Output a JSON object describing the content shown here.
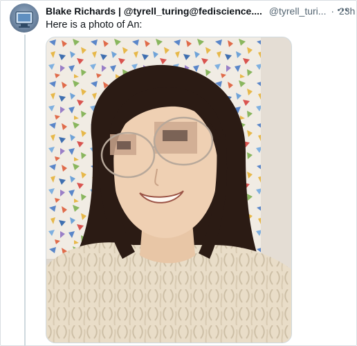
{
  "post": {
    "author_name": "Blake Richards | @tyrell_turing@fediscience....",
    "handle": "@tyrell_turi...",
    "separator": "·",
    "time": "23h",
    "text": "Here is a photo of An:"
  },
  "icons": {
    "more": "more-options-icon",
    "avatar": "avatar-image"
  },
  "colors": {
    "text_primary": "#0f1419",
    "text_secondary": "#536471",
    "border": "#cfd9de"
  }
}
